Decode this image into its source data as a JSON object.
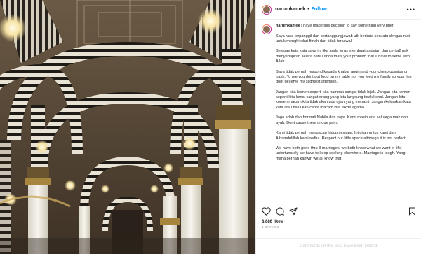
{
  "header": {
    "username": "narumkamek",
    "separator": "•",
    "follow_label": "Follow",
    "more_icon": "more-horizontal-icon"
  },
  "caption": {
    "username": "narumkamek",
    "paragraphs": [
      "I have made this decision to say something very brief.",
      "Saya rasa terpanggil dan bertanggungjawab utk berkata sesuatu dengan niat untuk menghindari fitnah dari tidak terkawal.",
      "Selepas kata kata saya ini jika anda terus membuat andaian dan cerita2 nak menyedapkan selera nafsu anda thats your problem that u have to settle with Allah.",
      "Saya tidak pernah respond kepada khabar angin and your cheap gossips or trash. To me you dont put food on my table nor you feed my family so your lies dont deserve my slightest attention.",
      "Jangan kita komen seperti kita nampak sangat tidak bijak. Jangan kita komen seperti kita kenal sangat orang yang kita langsung tidak kenal. Jangan kita komen macam kita tidak akan ada ujian yang menanti. Jangan keluarkan kata kata atau hasil kan cerita macam kita takde agama.",
      "Jaga adab dan hormati Nabila dan saya. Kami masih ada keluarga mak dan ayah. Dont cause them undue pain.",
      "Kami tidak pernah mengacau hidup sesiapa. Ini ujian untuk kami dan Alhamdulillah kami redha. Respect our little space although it is not perfect.",
      "We have both gone thru 3 marriages. we both know what we want in life, unfortunately we have to keep seeking elsewhere. Marriage is tough. Yang mana pernah kahwin we all know that"
    ]
  },
  "actions": {
    "icons": [
      "heart-icon",
      "comment-icon",
      "share-icon",
      "save-icon"
    ]
  },
  "likes_text": "8,886 likes",
  "time_text": "1 DAY AGO",
  "comment_placeholder": "Comments on this post have been limited."
}
